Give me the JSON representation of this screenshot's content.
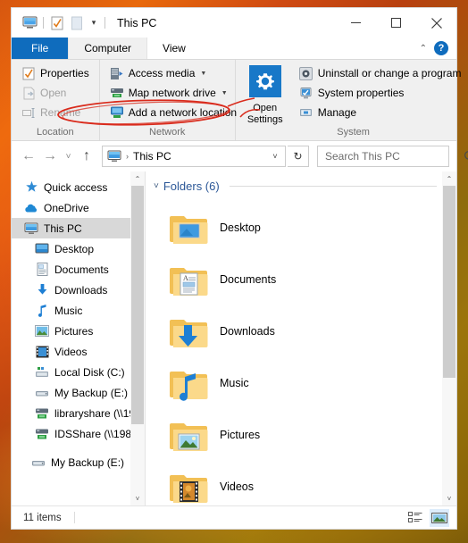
{
  "window": {
    "title": "This PC",
    "quick_access_icons": [
      "this-pc-monitor-icon",
      "properties-icon",
      "new-folder-icon"
    ],
    "quick_access_caret": "▾",
    "caption": {
      "minimize": "─",
      "maximize": "□",
      "close": "✕"
    }
  },
  "tabs": {
    "file": "File",
    "items": [
      {
        "label": "Computer",
        "active": true
      },
      {
        "label": "View",
        "active": false
      }
    ],
    "collapse_chevron": "⌃",
    "help_label": "?"
  },
  "ribbon": {
    "groups": [
      {
        "name": "Location",
        "label": "Location",
        "items": [
          {
            "label": "Properties",
            "icon": "properties-checkmark-icon",
            "disabled": false,
            "caret": false
          },
          {
            "label": "Open",
            "icon": "open-file-icon",
            "disabled": true,
            "caret": false
          },
          {
            "label": "Rename",
            "icon": "rename-icon",
            "disabled": true,
            "caret": false
          }
        ]
      },
      {
        "name": "Network",
        "label": "Network",
        "items": [
          {
            "label": "Access media",
            "icon": "access-media-icon",
            "disabled": false,
            "caret": true
          },
          {
            "label": "Map network drive",
            "icon": "map-network-drive-icon",
            "disabled": false,
            "caret": true
          },
          {
            "label": "Add a network location",
            "icon": "add-network-location-icon",
            "disabled": false,
            "caret": false
          }
        ]
      },
      {
        "name": "System",
        "label": "System",
        "big_button": {
          "label_line1": "Open",
          "label_line2": "Settings",
          "icon": "settings-gear-icon"
        },
        "items": [
          {
            "label": "Uninstall or change a program",
            "icon": "uninstall-program-icon",
            "disabled": false,
            "caret": false
          },
          {
            "label": "System properties",
            "icon": "system-properties-icon",
            "disabled": false,
            "caret": false
          },
          {
            "label": "Manage",
            "icon": "manage-icon",
            "disabled": false,
            "caret": false
          }
        ]
      }
    ],
    "annotation": {
      "shape": "red-ellipse",
      "target": "Add a network location",
      "color": "#d92b1c"
    }
  },
  "address_bar": {
    "back": "←",
    "forward": "→",
    "recent": "˅",
    "up": "↑",
    "breadcrumb_icon": "this-pc-monitor-icon",
    "breadcrumb_sep": "›",
    "breadcrumb": "This PC",
    "dropdown_caret": "˅",
    "refresh": "↻",
    "search_placeholder": "Search This PC",
    "search_value": "",
    "search_icon": "search-magnifier-icon"
  },
  "navpane": {
    "items": [
      {
        "label": "Quick access",
        "icon": "star-pin-icon",
        "level": 0,
        "selected": false
      },
      {
        "label": "OneDrive",
        "icon": "onedrive-cloud-icon",
        "level": 0,
        "selected": false
      },
      {
        "label": "This PC",
        "icon": "this-pc-monitor-icon",
        "level": 0,
        "selected": true
      },
      {
        "label": "Desktop",
        "icon": "desktop-icon",
        "level": 1,
        "selected": false
      },
      {
        "label": "Documents",
        "icon": "documents-icon",
        "level": 1,
        "selected": false
      },
      {
        "label": "Downloads",
        "icon": "downloads-arrow-icon",
        "level": 1,
        "selected": false
      },
      {
        "label": "Music",
        "icon": "music-note-icon",
        "level": 1,
        "selected": false
      },
      {
        "label": "Pictures",
        "icon": "pictures-icon",
        "level": 1,
        "selected": false
      },
      {
        "label": "Videos",
        "icon": "videos-filmstrip-icon",
        "level": 1,
        "selected": false
      },
      {
        "label": "Local Disk (C:)",
        "icon": "local-disk-icon",
        "level": 1,
        "selected": false
      },
      {
        "label": "My Backup (E:)",
        "icon": "drive-icon",
        "level": 1,
        "selected": false
      },
      {
        "label": "libraryshare (\\\\19",
        "icon": "network-drive-icon",
        "level": 1,
        "selected": false
      },
      {
        "label": "IDSShare (\\\\198.",
        "icon": "network-drive-icon",
        "level": 1,
        "selected": false
      },
      {
        "label": "My Backup (E:)",
        "icon": "drive-icon",
        "level": 0,
        "selected": false,
        "gap_before": true
      }
    ],
    "scrollbar": {
      "up": "⌃",
      "down": "˅",
      "thumb_top_pct": 0,
      "thumb_height_pct": 78
    }
  },
  "content": {
    "group_header": {
      "chevron": "˅",
      "label": "Folders (6)"
    },
    "folders": [
      {
        "label": "Desktop",
        "icon": "folder-desktop-icon"
      },
      {
        "label": "Documents",
        "icon": "folder-documents-icon"
      },
      {
        "label": "Downloads",
        "icon": "folder-downloads-icon"
      },
      {
        "label": "Music",
        "icon": "folder-music-icon"
      },
      {
        "label": "Pictures",
        "icon": "folder-pictures-icon"
      },
      {
        "label": "Videos",
        "icon": "folder-videos-icon"
      }
    ],
    "scrollbar": {
      "up": "⌃",
      "down": "˅",
      "thumb_top_pct": 0,
      "thumb_height_pct": 63
    }
  },
  "statusbar": {
    "item_count": "11 items",
    "views": [
      {
        "name": "details-view-button",
        "active": false
      },
      {
        "name": "large-icons-view-button",
        "active": true
      }
    ]
  },
  "colors": {
    "accent": "#0f6cbd",
    "annotation_red": "#d92b1c",
    "group_header_blue": "#2b5797",
    "selection_gray": "#d8d8d8"
  }
}
